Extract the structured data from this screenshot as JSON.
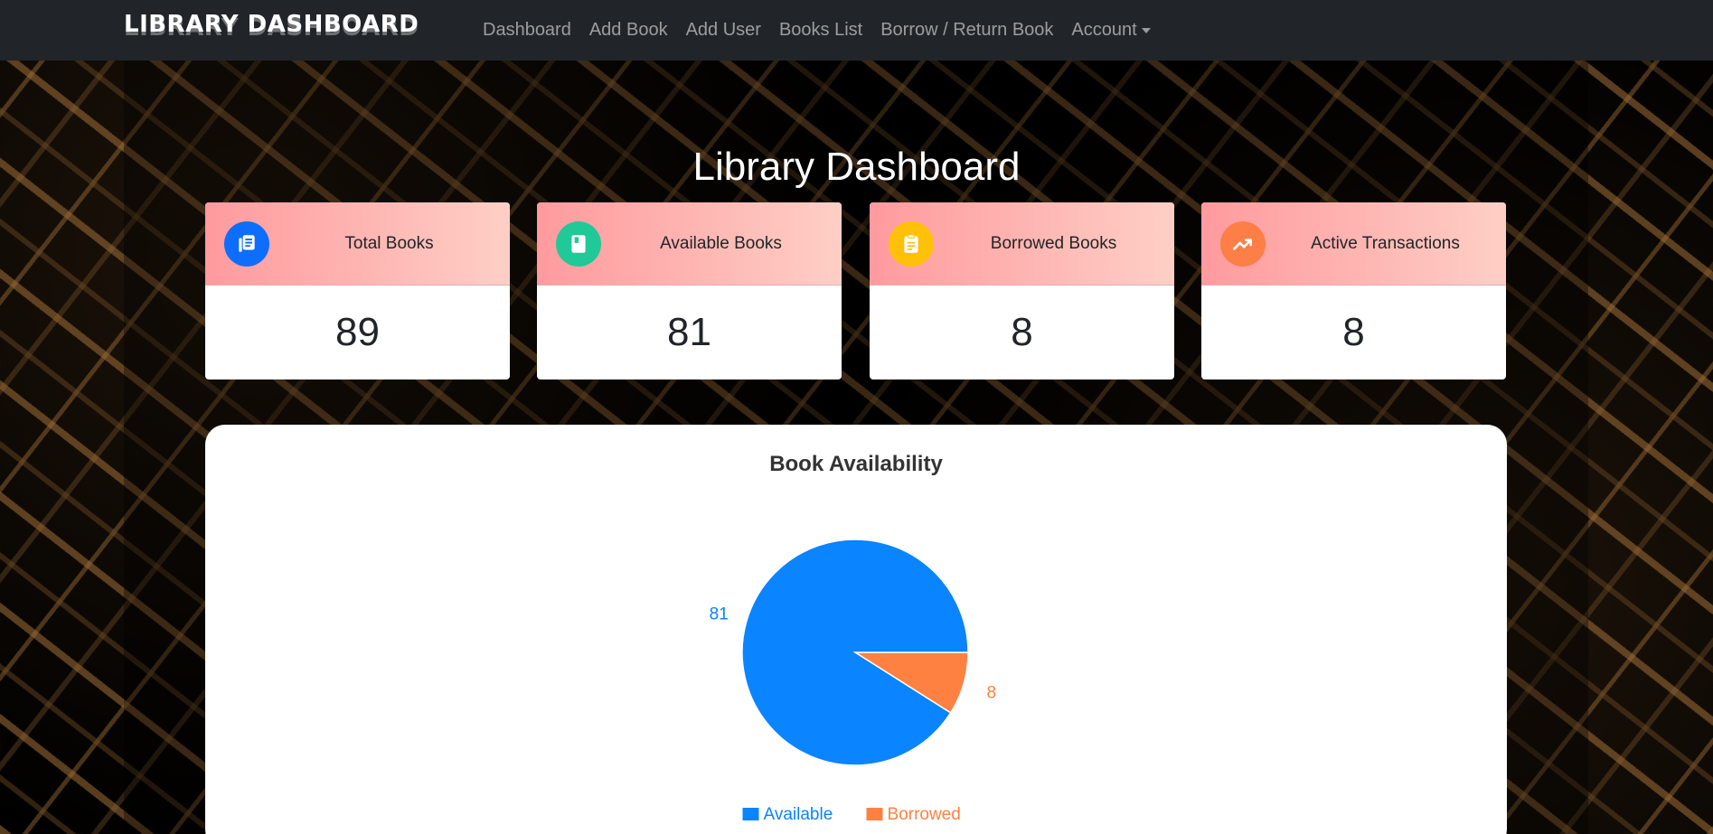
{
  "nav": {
    "brand": "LIBRARY DASHBOARD",
    "links": [
      "Dashboard",
      "Add Book",
      "Add User",
      "Books List",
      "Borrow / Return Book"
    ],
    "account": "Account"
  },
  "page_title": "Library Dashboard",
  "stats": [
    {
      "label": "Total Books",
      "value": "89",
      "icon": "library-books-icon",
      "color": "#0d6efd"
    },
    {
      "label": "Available Books",
      "value": "81",
      "icon": "book-icon",
      "color": "#20c997"
    },
    {
      "label": "Borrowed Books",
      "value": "8",
      "icon": "clipboard-icon",
      "color": "#ffc107"
    },
    {
      "label": "Active Transactions",
      "value": "8",
      "icon": "trending-up-icon",
      "color": "#fd7e46"
    }
  ],
  "chart_data": {
    "type": "pie",
    "title": "Book Availability",
    "categories": [
      "Available",
      "Borrowed"
    ],
    "values": [
      81,
      8
    ],
    "colors": [
      "#0a84ff",
      "#ff8142"
    ],
    "legend": "bottom"
  }
}
